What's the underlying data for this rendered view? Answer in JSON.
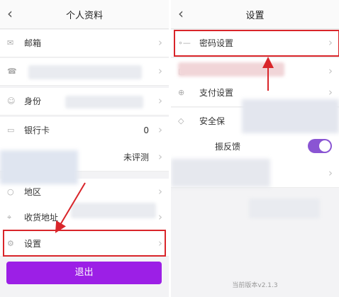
{
  "left": {
    "title": "个人资料",
    "rows": [
      {
        "label": "邮箱",
        "value": "",
        "icon": "mail-icon"
      },
      {
        "label": "",
        "value": "",
        "icon": "phone-icon"
      },
      {
        "label": "身份",
        "value": "",
        "icon": "id-card-icon"
      },
      {
        "label": "银行卡",
        "value": "0",
        "icon": "bank-card-icon"
      },
      {
        "label": "",
        "value": "未评测",
        "icon": "assessment-icon"
      },
      {
        "label": "地区",
        "value": "",
        "icon": "region-icon"
      },
      {
        "label": "收货地址",
        "value": "",
        "icon": "location-pin-icon"
      },
      {
        "label": "设置",
        "value": "",
        "icon": "gear-icon"
      }
    ],
    "logout_label": "退出"
  },
  "right": {
    "title": "设置",
    "rows": [
      {
        "label": "密码设置",
        "icon": "key-icon"
      },
      {
        "label": "",
        "icon": "lock-icon"
      },
      {
        "label": "支付设置",
        "icon": "payment-icon"
      },
      {
        "label": "安全保",
        "icon": "shield-icon"
      },
      {
        "label": "振反馈",
        "icon": "vibration-icon",
        "toggle": true
      },
      {
        "label": "",
        "icon": "none"
      },
      {
        "label": "",
        "icon": "none"
      }
    ],
    "version": "当前版本v2.1.3"
  },
  "colors": {
    "highlight": "#d9252a",
    "logout_bg": "#9c1fe6",
    "toggle_on": "#8a55d3"
  }
}
